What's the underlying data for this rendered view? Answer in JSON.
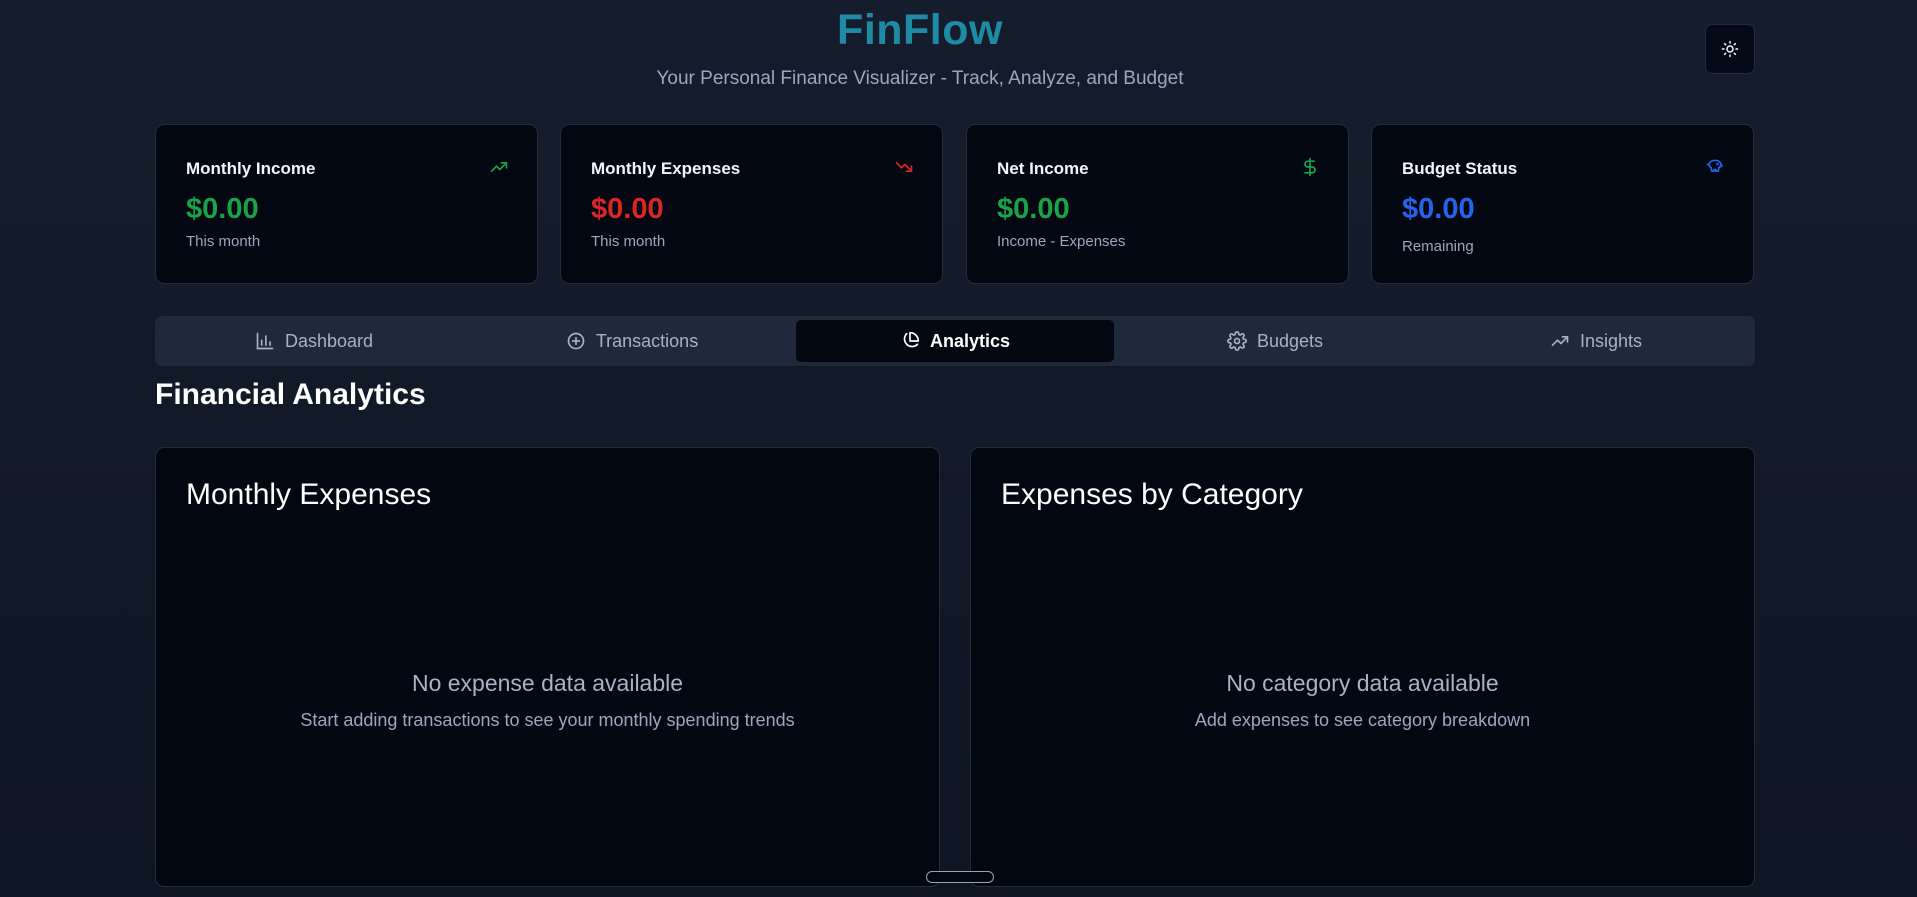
{
  "app": {
    "title": "FinFlow",
    "subtitle": "Your Personal Finance Visualizer - Track, Analyze, and Budget"
  },
  "theme_toggle": {
    "icon": "sun-icon"
  },
  "cards": [
    {
      "title": "Monthly Income",
      "value": "$0.00",
      "sub": "This month",
      "icon": "trending-up-icon",
      "color": "#16a34a"
    },
    {
      "title": "Monthly Expenses",
      "value": "$0.00",
      "sub": "This month",
      "icon": "trending-down-icon",
      "color": "#dc2626"
    },
    {
      "title": "Net Income",
      "value": "$0.00",
      "sub": "Income - Expenses",
      "icon": "dollar-icon",
      "color": "#16a34a"
    },
    {
      "title": "Budget Status",
      "value": "$0.00",
      "sub": "Remaining",
      "icon": "piggy-bank-icon",
      "color": "#2563eb"
    }
  ],
  "tabs": [
    {
      "label": "Dashboard",
      "icon": "bar-chart-icon",
      "active": false
    },
    {
      "label": "Transactions",
      "icon": "plus-circle-icon",
      "active": false
    },
    {
      "label": "Analytics",
      "icon": "pie-chart-icon",
      "active": true
    },
    {
      "label": "Budgets",
      "icon": "gear-icon",
      "active": false
    },
    {
      "label": "Insights",
      "icon": "trending-up-icon",
      "active": false
    }
  ],
  "section": {
    "title": "Financial Analytics"
  },
  "panels": [
    {
      "title": "Monthly Expenses",
      "empty_title": "No expense data available",
      "empty_desc": "Start adding transactions to see your monthly spending trends"
    },
    {
      "title": "Expenses by Category",
      "empty_title": "No category data available",
      "empty_desc": "Add expenses to see category breakdown"
    }
  ]
}
